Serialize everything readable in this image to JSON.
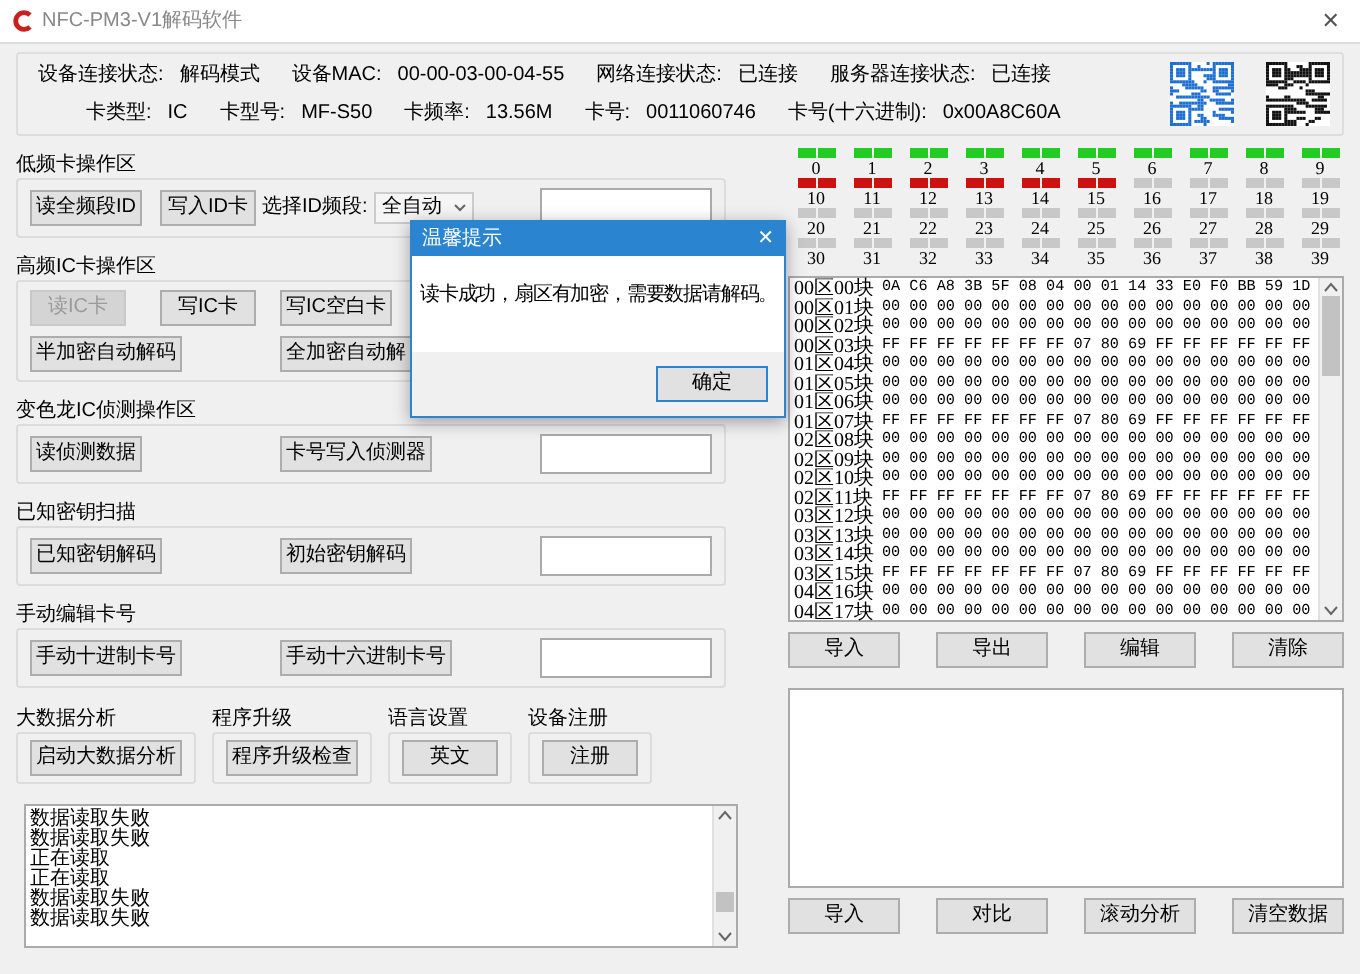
{
  "window": {
    "title": "NFC-PM3-V1解码软件",
    "close": "✕"
  },
  "info_rows": [
    [
      {
        "label": "设备连接状态:",
        "value": "解码模式"
      },
      {
        "label": "设备MAC:",
        "value": "00-00-03-00-04-55"
      },
      {
        "label": "网络连接状态:",
        "value": "已连接"
      },
      {
        "label": "服务器连接状态:",
        "value": "已连接"
      }
    ],
    [
      {
        "label": "卡类型:",
        "value": "IC"
      },
      {
        "label": "卡型号:",
        "value": "MF-S50"
      },
      {
        "label": "卡频率:",
        "value": "13.56M"
      },
      {
        "label": "卡号:",
        "value": "0011060746"
      },
      {
        "label": "卡号(十六进制):",
        "value": "0x00A8C60A"
      }
    ]
  ],
  "sections": [
    {
      "title": "低频卡操作区",
      "rows": [
        [
          {
            "kind": "button",
            "label": "读全频段ID",
            "disabled": false
          },
          {
            "kind": "button",
            "label": "写入ID卡",
            "disabled": false
          },
          {
            "kind": "select",
            "label": "选择ID频段:",
            "value": "全自动"
          },
          {
            "kind": "field"
          }
        ]
      ]
    },
    {
      "title": "高频IC卡操作区",
      "rows": [
        [
          {
            "kind": "button",
            "label": "读IC卡",
            "disabled": true
          },
          {
            "kind": "button",
            "label": "写IC卡",
            "disabled": false
          },
          {
            "kind": "button",
            "label": "写IC空白卡",
            "disabled": false
          }
        ],
        [
          {
            "kind": "button",
            "label": "半加密自动解码",
            "disabled": false
          },
          "",
          {
            "kind": "button",
            "label": "全加密自动解",
            "disabled": false
          }
        ]
      ]
    },
    {
      "title": "变色龙IC侦测操作区",
      "rows": [
        [
          {
            "kind": "button",
            "label": "读侦测数据",
            "disabled": false
          },
          "",
          {
            "kind": "button",
            "label": "卡号写入侦测器",
            "disabled": false
          },
          {
            "kind": "field"
          }
        ]
      ]
    },
    {
      "title": "已知密钥扫描",
      "rows": [
        [
          {
            "kind": "button",
            "label": "已知密钥解码",
            "disabled": false
          },
          "",
          {
            "kind": "button",
            "label": "初始密钥解码",
            "disabled": false
          },
          {
            "kind": "field"
          }
        ]
      ]
    },
    {
      "title": "手动编辑卡号",
      "rows": [
        [
          {
            "kind": "button",
            "label": "手动十进制卡号",
            "disabled": false
          },
          "",
          {
            "kind": "button",
            "label": "手动十六进制卡号",
            "disabled": false
          },
          {
            "kind": "field"
          }
        ]
      ]
    }
  ],
  "small_groups": [
    {
      "title": "大数据分析",
      "button": "启动大数据分析"
    },
    {
      "title": "程序升级",
      "button": "程序升级检查"
    },
    {
      "title": "语言设置",
      "button": "英文"
    },
    {
      "title": "设备注册",
      "button": "注册"
    }
  ],
  "log": [
    "数据读取失败",
    "数据读取失败",
    "正在读取",
    "正在读取",
    "数据读取失败",
    "数据读取失败"
  ],
  "sectors": [
    {
      "label": "0",
      "color": "#22cc22"
    },
    {
      "label": "1",
      "color": "#22cc22"
    },
    {
      "label": "2",
      "color": "#22cc22"
    },
    {
      "label": "3",
      "color": "#22cc22"
    },
    {
      "label": "4",
      "color": "#22cc22"
    },
    {
      "label": "5",
      "color": "#22cc22"
    },
    {
      "label": "6",
      "color": "#22cc22"
    },
    {
      "label": "7",
      "color": "#22cc22"
    },
    {
      "label": "8",
      "color": "#22cc22"
    },
    {
      "label": "9",
      "color": "#22cc22"
    },
    {
      "label": "10",
      "color": "#cc1111"
    },
    {
      "label": "11",
      "color": "#cc1111"
    },
    {
      "label": "12",
      "color": "#cc1111"
    },
    {
      "label": "13",
      "color": "#cc1111"
    },
    {
      "label": "14",
      "color": "#cc1111"
    },
    {
      "label": "15",
      "color": "#cc1111"
    },
    {
      "label": "16",
      "color": "#c8c8c8"
    },
    {
      "label": "17",
      "color": "#c8c8c8"
    },
    {
      "label": "18",
      "color": "#c8c8c8"
    },
    {
      "label": "19",
      "color": "#c8c8c8"
    },
    {
      "label": "20",
      "color": "#c8c8c8"
    },
    {
      "label": "21",
      "color": "#c8c8c8"
    },
    {
      "label": "22",
      "color": "#c8c8c8"
    },
    {
      "label": "23",
      "color": "#c8c8c8"
    },
    {
      "label": "24",
      "color": "#c8c8c8"
    },
    {
      "label": "25",
      "color": "#c8c8c8"
    },
    {
      "label": "26",
      "color": "#c8c8c8"
    },
    {
      "label": "27",
      "color": "#c8c8c8"
    },
    {
      "label": "28",
      "color": "#c8c8c8"
    },
    {
      "label": "29",
      "color": "#c8c8c8"
    },
    {
      "label": "30",
      "color": "#c8c8c8"
    },
    {
      "label": "31",
      "color": "#c8c8c8"
    },
    {
      "label": "32",
      "color": "#c8c8c8"
    },
    {
      "label": "33",
      "color": "#c8c8c8"
    },
    {
      "label": "34",
      "color": "#c8c8c8"
    },
    {
      "label": "35",
      "color": "#c8c8c8"
    },
    {
      "label": "36",
      "color": "#c8c8c8"
    },
    {
      "label": "37",
      "color": "#c8c8c8"
    },
    {
      "label": "38",
      "color": "#c8c8c8"
    },
    {
      "label": "39",
      "color": "#c8c8c8"
    }
  ],
  "blocks": [
    {
      "label": "00区00块",
      "bytes": "0A C6 A8 3B 5F 08 04 00 01 14 33 E0 F0 BB 59 1D"
    },
    {
      "label": "00区01块",
      "bytes": "00 00 00 00 00 00 00 00 00 00 00 00 00 00 00 00"
    },
    {
      "label": "00区02块",
      "bytes": "00 00 00 00 00 00 00 00 00 00 00 00 00 00 00 00"
    },
    {
      "label": "00区03块",
      "bytes": "FF FF FF FF FF FF FF 07 80 69 FF FF FF FF FF FF"
    },
    {
      "label": "01区04块",
      "bytes": "00 00 00 00 00 00 00 00 00 00 00 00 00 00 00 00"
    },
    {
      "label": "01区05块",
      "bytes": "00 00 00 00 00 00 00 00 00 00 00 00 00 00 00 00"
    },
    {
      "label": "01区06块",
      "bytes": "00 00 00 00 00 00 00 00 00 00 00 00 00 00 00 00"
    },
    {
      "label": "01区07块",
      "bytes": "FF FF FF FF FF FF FF 07 80 69 FF FF FF FF FF FF"
    },
    {
      "label": "02区08块",
      "bytes": "00 00 00 00 00 00 00 00 00 00 00 00 00 00 00 00"
    },
    {
      "label": "02区09块",
      "bytes": "00 00 00 00 00 00 00 00 00 00 00 00 00 00 00 00"
    },
    {
      "label": "02区10块",
      "bytes": "00 00 00 00 00 00 00 00 00 00 00 00 00 00 00 00"
    },
    {
      "label": "02区11块",
      "bytes": "FF FF FF FF FF FF FF 07 80 69 FF FF FF FF FF FF"
    },
    {
      "label": "03区12块",
      "bytes": "00 00 00 00 00 00 00 00 00 00 00 00 00 00 00 00"
    },
    {
      "label": "03区13块",
      "bytes": "00 00 00 00 00 00 00 00 00 00 00 00 00 00 00 00"
    },
    {
      "label": "03区14块",
      "bytes": "00 00 00 00 00 00 00 00 00 00 00 00 00 00 00 00"
    },
    {
      "label": "03区15块",
      "bytes": "FF FF FF FF FF FF FF 07 80 69 FF FF FF FF FF FF"
    },
    {
      "label": "04区16块",
      "bytes": "00 00 00 00 00 00 00 00 00 00 00 00 00 00 00 00"
    },
    {
      "label": "04区17块",
      "bytes": "00 00 00 00 00 00 00 00 00 00 00 00 00 00 00 00"
    }
  ],
  "data_buttons": [
    "导入",
    "导出",
    "编辑",
    "清除"
  ],
  "compare_buttons": [
    "导入",
    "对比",
    "滚动分析",
    "清空数据"
  ],
  "dialog": {
    "title": "温馨提示",
    "close": "✕",
    "message": "读卡成功，扇区有加密，需要数据请解码。",
    "button": "确定"
  }
}
